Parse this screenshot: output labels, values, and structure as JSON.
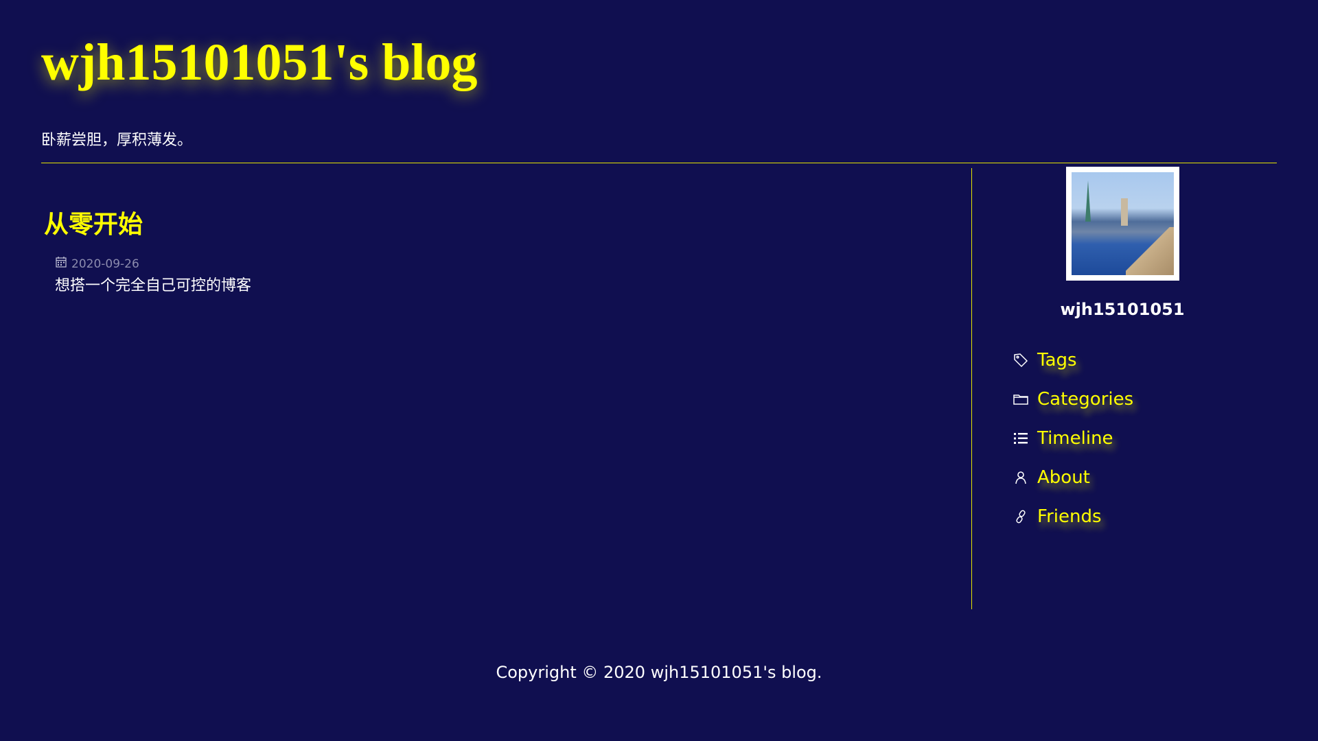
{
  "header": {
    "title": "wjh15101051's blog",
    "subtitle": "卧薪尝胆，厚积薄发。"
  },
  "posts": [
    {
      "title": "从零开始",
      "date": "2020-09-26",
      "excerpt": "想搭一个完全自己可控的博客"
    }
  ],
  "sidebar": {
    "author": "wjh15101051",
    "menu": [
      {
        "label": "Tags",
        "icon": "tag-icon"
      },
      {
        "label": "Categories",
        "icon": "folder-icon"
      },
      {
        "label": "Timeline",
        "icon": "list-icon"
      },
      {
        "label": "About",
        "icon": "user-icon"
      },
      {
        "label": "Friends",
        "icon": "link-icon"
      }
    ]
  },
  "footer": {
    "copyright": "Copyright © 2020 wjh15101051's blog."
  },
  "colors": {
    "background": "#100f50",
    "accent": "#ffff00"
  }
}
